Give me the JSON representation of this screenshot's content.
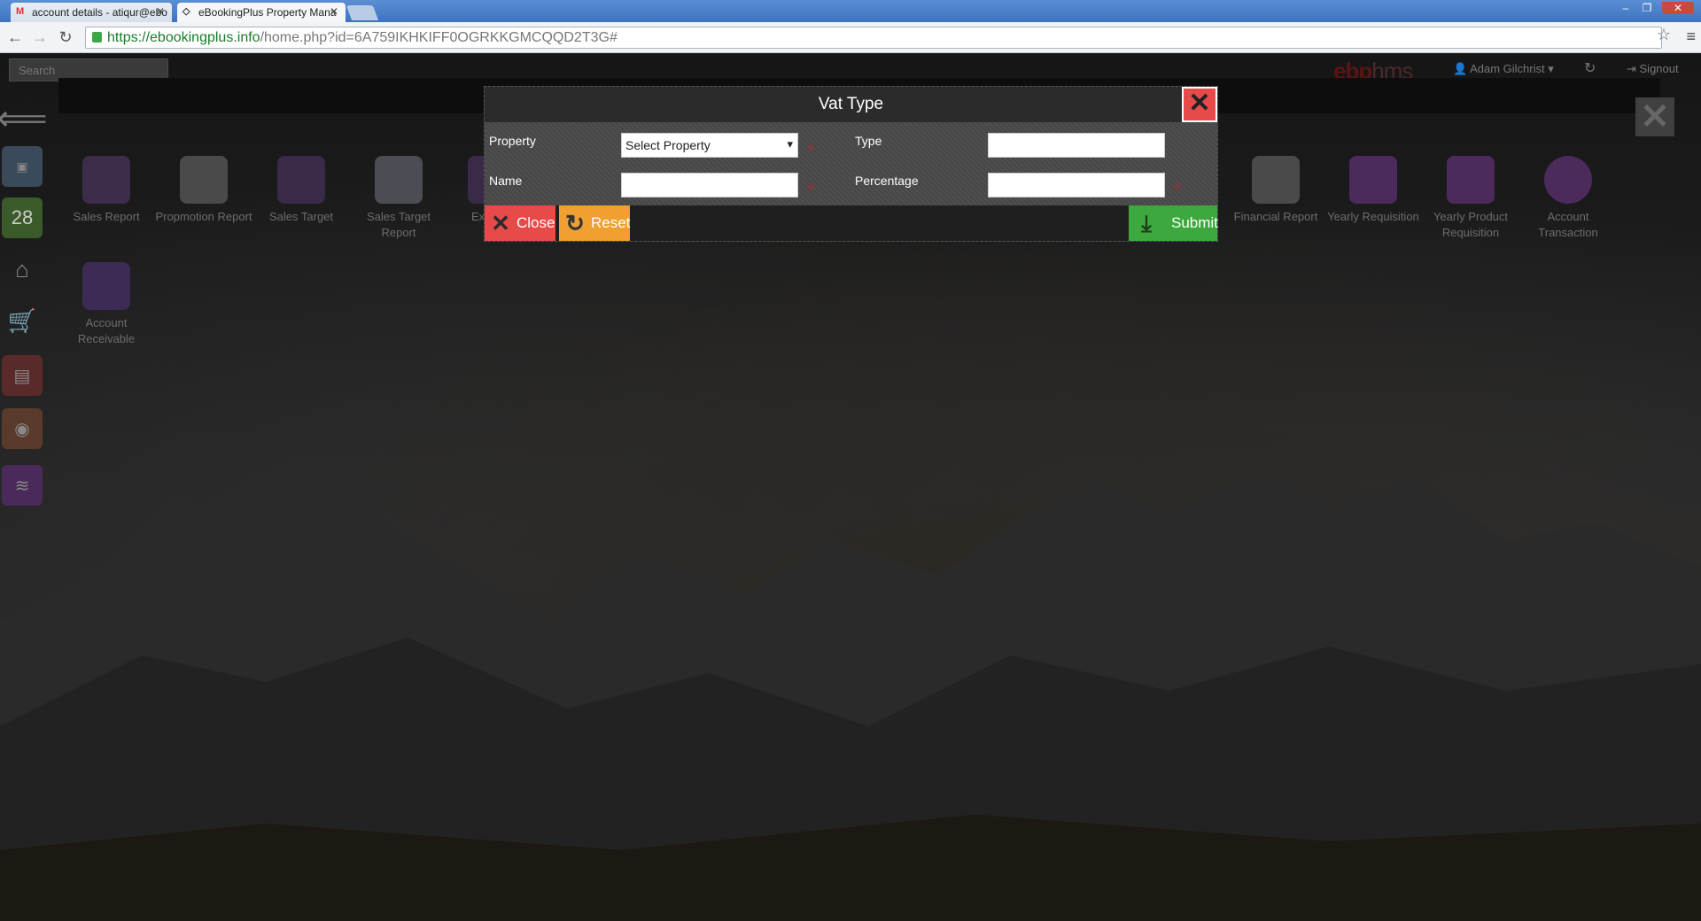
{
  "browser": {
    "tabs": [
      {
        "label": "account details - atiqur@ebo",
        "icon": "gmail-icon"
      },
      {
        "label": "eBookingPlus Property Mana",
        "icon": "site-icon"
      }
    ],
    "url_host": "https://ebookingplus.info",
    "url_path": "/home.php?id=6A759IKHKIFF0OGRKKGMCQQD2T3G#"
  },
  "topbar": {
    "search_placeholder": "Search",
    "brand_a": "ebp",
    "brand_b": "hms",
    "user": "Adam Gilchrist",
    "signout": "Signout"
  },
  "tiles": [
    {
      "label": "Sales Report",
      "color": "#3d2d4a"
    },
    {
      "label": "Propmotion Report",
      "color": "#4a4a4a"
    },
    {
      "label": "Sales Target",
      "color": "#3a2a4a"
    },
    {
      "label": "Sales Target Report",
      "color": "#4c4c55"
    },
    {
      "label": "Ex",
      "color": "#3a2a4a"
    },
    {
      "label": "Financial Report",
      "color": "#4a4a4a"
    },
    {
      "label": "Yearly Requisition",
      "color": "#4d2a5c"
    },
    {
      "label": "Yearly Product Requisition",
      "color": "#4d2a5c"
    },
    {
      "label": "Account Transaction",
      "color": "#4d2a5c"
    },
    {
      "label": "Account Receivable",
      "color": "#3d2a55"
    }
  ],
  "modal": {
    "title": "Vat Type",
    "property_label": "Property",
    "property_value": "Select Property",
    "type_label": "Type",
    "type_value": "",
    "name_label": "Name",
    "name_value": "",
    "percentage_label": "Percentage",
    "percentage_value": "",
    "close": "Close",
    "reset": "Reset",
    "submit": "Submit"
  }
}
